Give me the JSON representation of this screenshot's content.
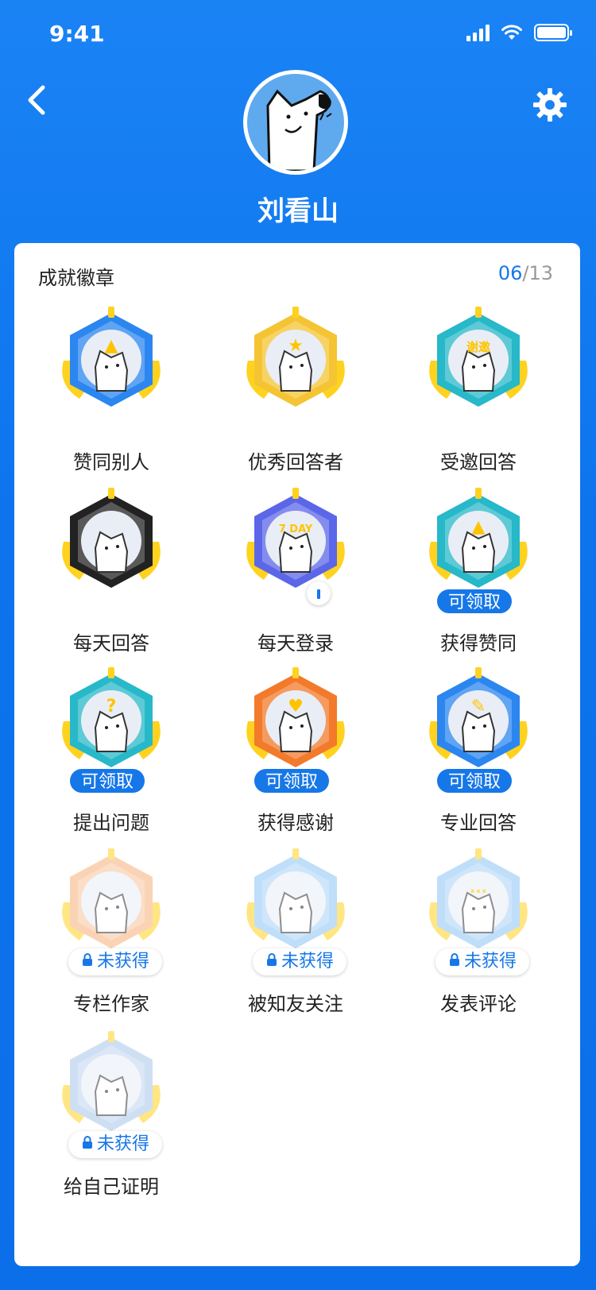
{
  "status": {
    "time": "9:41"
  },
  "profile": {
    "name": "刘看山"
  },
  "section": {
    "title": "成就徽章",
    "earned": "06",
    "separator": "/",
    "total": "13"
  },
  "badges": [
    {
      "label": "赞同别人",
      "state": "",
      "accent": "#2b86f0",
      "glyph": "▲"
    },
    {
      "label": "优秀回答者",
      "state": "",
      "accent": "#f5c433",
      "glyph": "★"
    },
    {
      "label": "受邀回答",
      "state": "",
      "accent": "#27b8c9",
      "glyph": "谢邀"
    },
    {
      "label": "每天回答",
      "state": "",
      "accent": "#222222",
      "glyph": ""
    },
    {
      "label": "每天登录",
      "state": "",
      "accent": "#5b67e8",
      "glyph": "7 DAY"
    },
    {
      "label": "获得赞同",
      "state": "可领取",
      "accent": "#27b8c9",
      "glyph": "▲"
    },
    {
      "label": "提出问题",
      "state": "可领取",
      "accent": "#27b8c9",
      "glyph": "?"
    },
    {
      "label": "获得感谢",
      "state": "可领取",
      "accent": "#f27a2a",
      "glyph": "♥"
    },
    {
      "label": "专业回答",
      "state": "可领取",
      "accent": "#2b86f0",
      "glyph": "✎"
    },
    {
      "label": "专栏作家",
      "state": "未获得",
      "accent": "#f7b07a",
      "glyph": ""
    },
    {
      "label": "被知友关注",
      "state": "未获得",
      "accent": "#8cc4f5",
      "glyph": ""
    },
    {
      "label": "发表评论",
      "state": "未获得",
      "accent": "#8cc4f5",
      "glyph": "…"
    },
    {
      "label": "给自己证明",
      "state": "未获得",
      "accent": "#a9c6ea",
      "glyph": ""
    }
  ]
}
